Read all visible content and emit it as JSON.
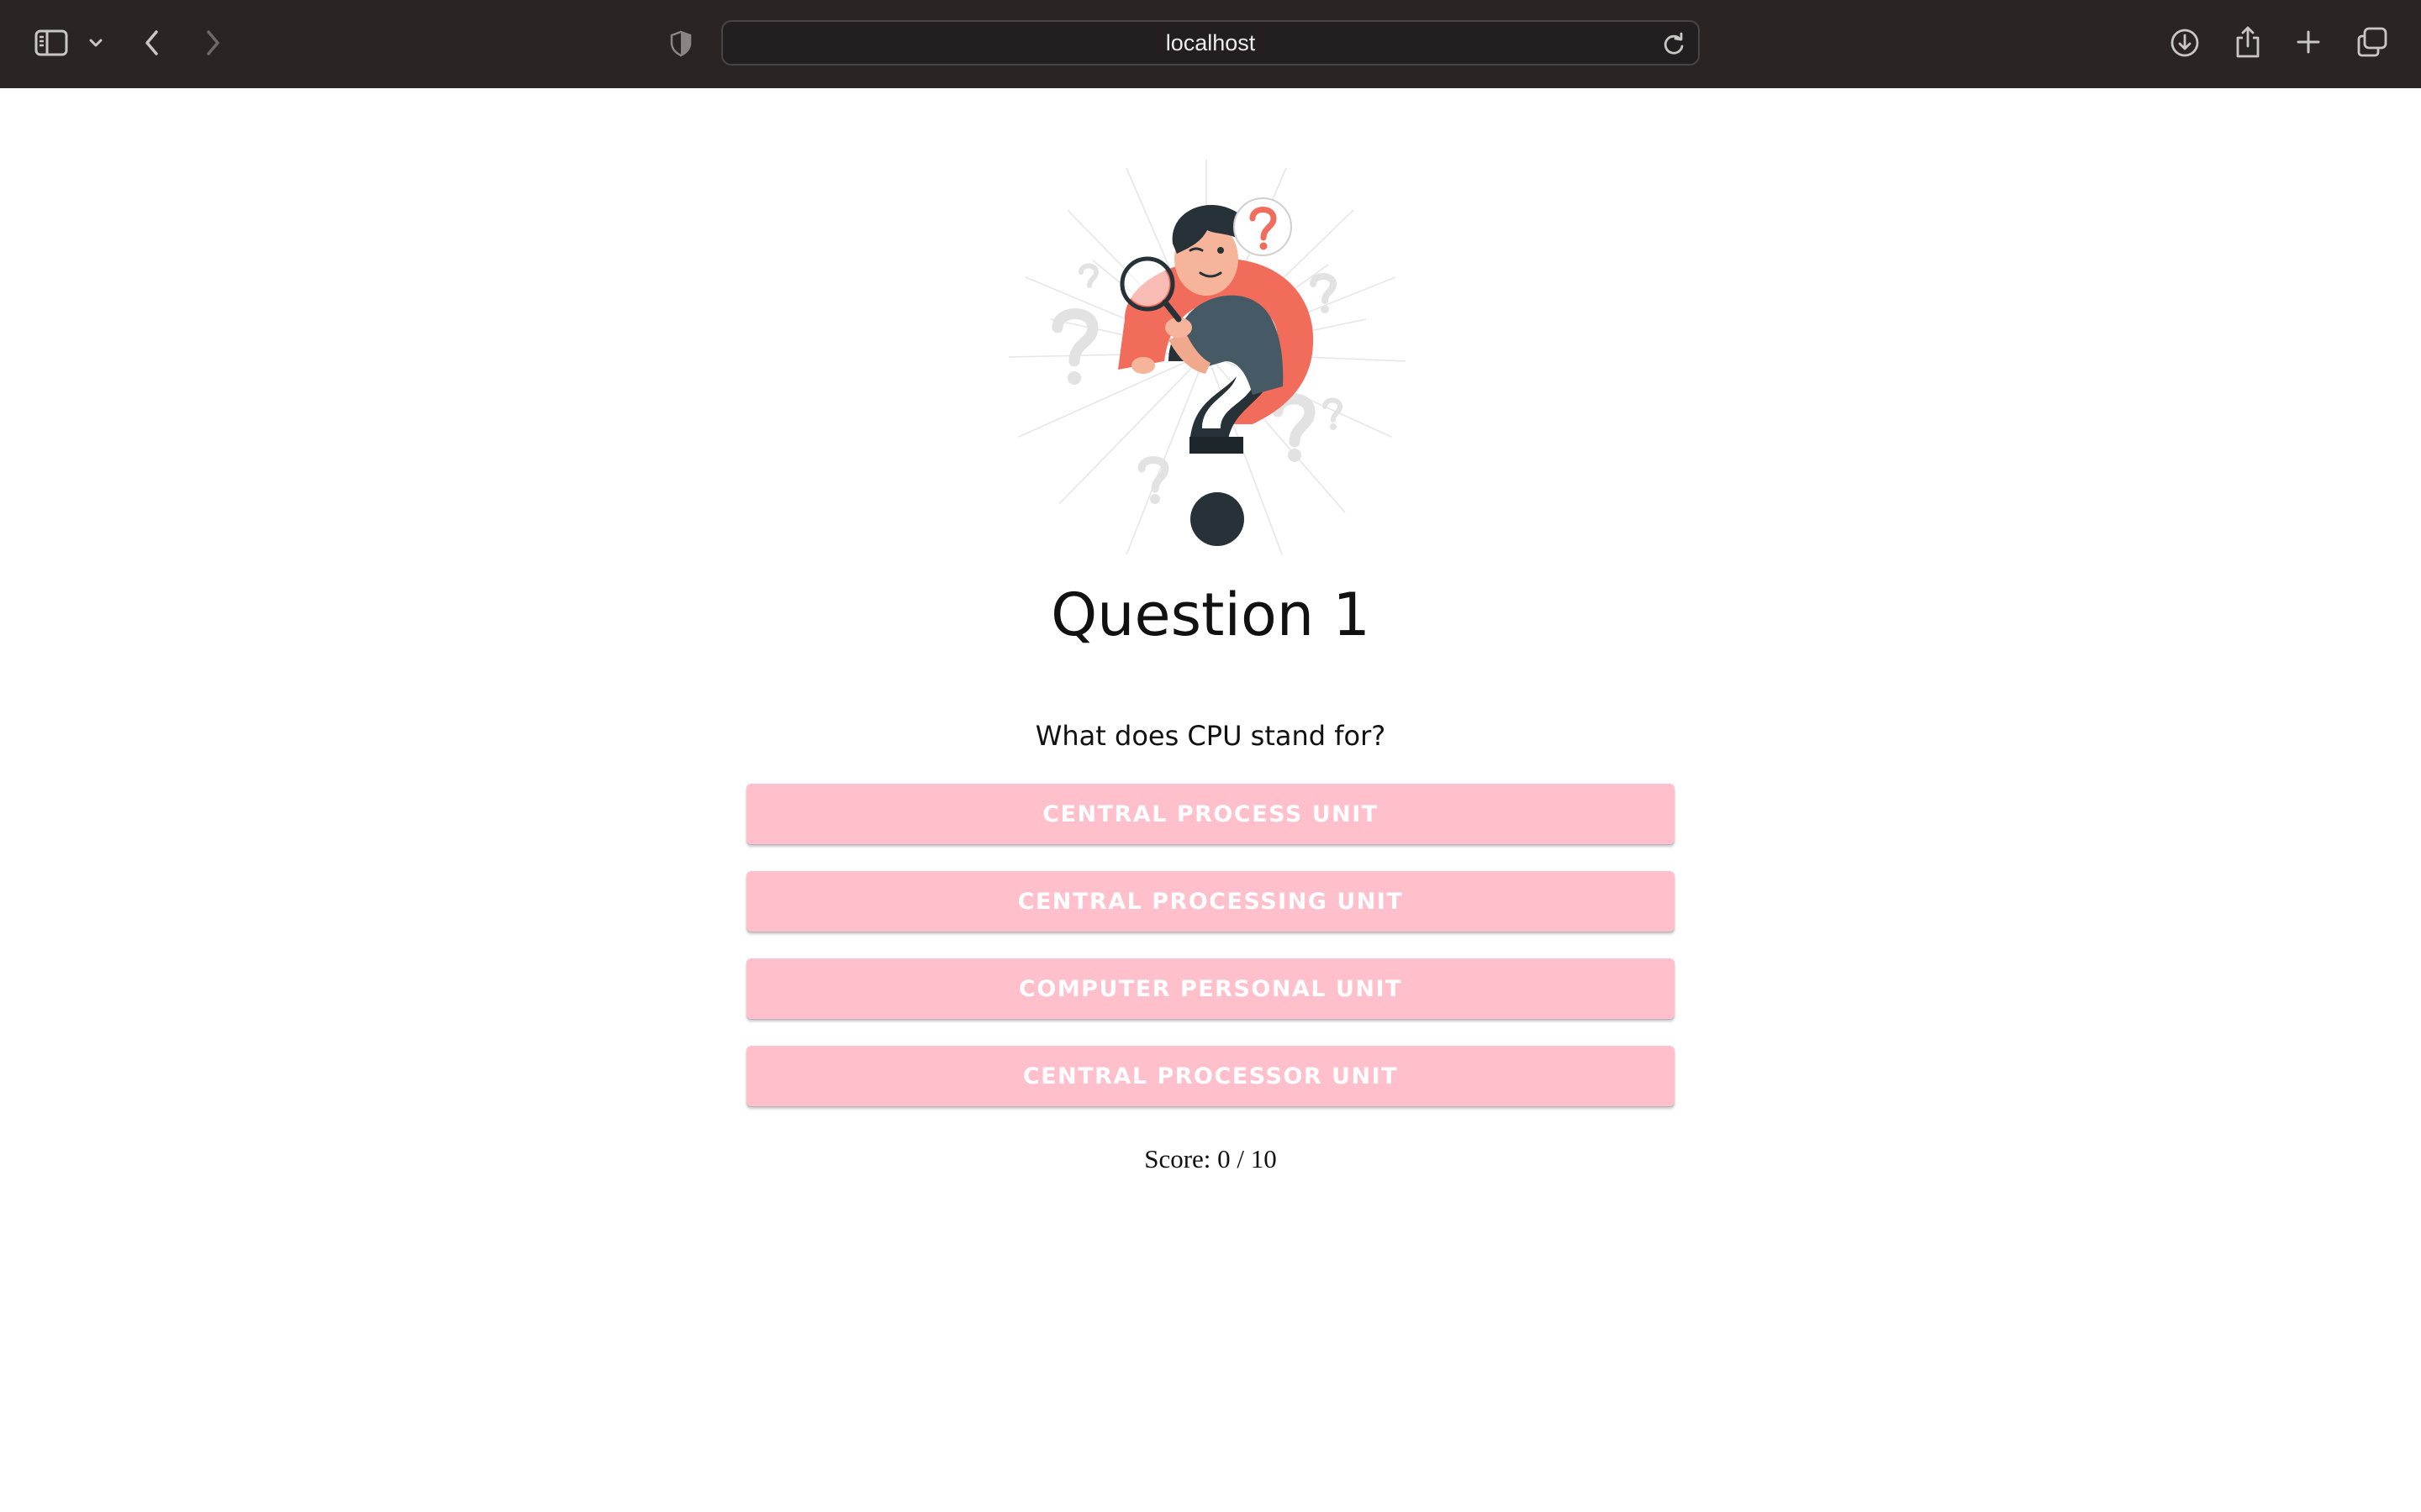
{
  "browser": {
    "url": "localhost",
    "icons": {
      "sidebar": "sidebar-icon",
      "tab_menu": "chevron-down-icon",
      "back": "chevron-left-icon",
      "forward": "chevron-right-icon",
      "privacy": "shield-icon",
      "reload": "reload-icon",
      "downloads": "download-icon",
      "share": "share-icon",
      "new_tab": "plus-icon",
      "tabs": "tabs-overview-icon"
    }
  },
  "quiz": {
    "title": "Question 1",
    "question": "What does CPU stand for?",
    "answers": [
      {
        "label": "CENTRAL PROCESS UNIT"
      },
      {
        "label": "CENTRAL PROCESSING UNIT"
      },
      {
        "label": "COMPUTER PERSONAL UNIT"
      },
      {
        "label": "CENTRAL PROCESSOR UNIT"
      }
    ],
    "score_text": "Score: 0 / 10",
    "illustration": "thinking-person-question-mark-illustration"
  },
  "colors": {
    "toolbar_bg": "#2a2425",
    "answer_bg": "#ffbfcb",
    "answer_text": "#ffffff",
    "accent_coral": "#f26c5b",
    "dark_teal": "#263238"
  }
}
